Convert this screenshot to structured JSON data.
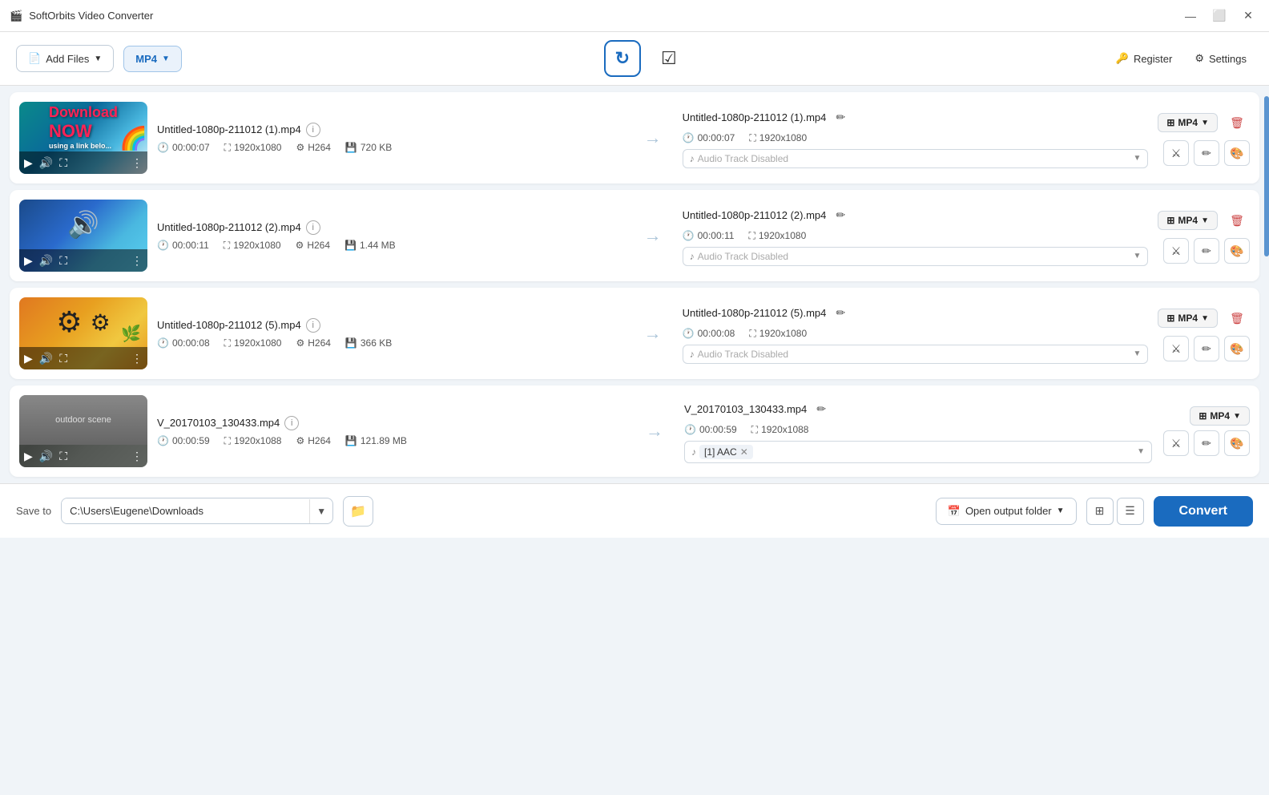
{
  "app": {
    "title": "SoftOrbits Video Converter",
    "icon": "🎬"
  },
  "titlebar": {
    "minimize": "—",
    "maximize": "⬜",
    "close": "✕"
  },
  "toolbar": {
    "add_files_label": "Add Files",
    "format_label": "MP4",
    "refresh_icon": "↻",
    "check_icon": "☑",
    "register_label": "Register",
    "settings_label": "Settings"
  },
  "files": [
    {
      "id": 1,
      "input_name": "Untitled-1080p-211012 (1).mp4",
      "input_duration": "00:00:07",
      "input_resolution": "1920x1080",
      "input_codec": "H264",
      "input_size": "720 KB",
      "output_name": "Untitled-1080p-211012 (1).mp4",
      "output_duration": "00:00:07",
      "output_resolution": "1920x1080",
      "output_format": "MP4",
      "audio": "Audio Track Disabled",
      "audio_type": "disabled",
      "thumb_class": "thumb-1"
    },
    {
      "id": 2,
      "input_name": "Untitled-1080p-211012 (2).mp4",
      "input_duration": "00:00:11",
      "input_resolution": "1920x1080",
      "input_codec": "H264",
      "input_size": "1.44 MB",
      "output_name": "Untitled-1080p-211012 (2).mp4",
      "output_duration": "00:00:11",
      "output_resolution": "1920x1080",
      "output_format": "MP4",
      "audio": "Audio Track Disabled",
      "audio_type": "disabled",
      "thumb_class": "thumb-2"
    },
    {
      "id": 3,
      "input_name": "Untitled-1080p-211012 (5).mp4",
      "input_duration": "00:00:08",
      "input_resolution": "1920x1080",
      "input_codec": "H264",
      "input_size": "366 KB",
      "output_name": "Untitled-1080p-211012 (5).mp4",
      "output_duration": "00:00:08",
      "output_resolution": "1920x1080",
      "output_format": "MP4",
      "audio": "Audio Track Disabled",
      "audio_type": "disabled",
      "thumb_class": "thumb-3"
    },
    {
      "id": 4,
      "input_name": "V_20170103_130433.mp4",
      "input_duration": "00:00:59",
      "input_resolution": "1920x1088",
      "input_codec": "H264",
      "input_size": "121.89 MB",
      "output_name": "V_20170103_130433.mp4",
      "output_duration": "00:00:59",
      "output_resolution": "1920x1088",
      "output_format": "MP4",
      "audio": "[1] AAC",
      "audio_type": "aac",
      "thumb_class": "thumb-4"
    }
  ],
  "bottom": {
    "save_to_label": "Save to",
    "save_to_path": "C:\\Users\\Eugene\\Downloads",
    "open_output_label": "Open output folder",
    "convert_label": "Convert"
  }
}
